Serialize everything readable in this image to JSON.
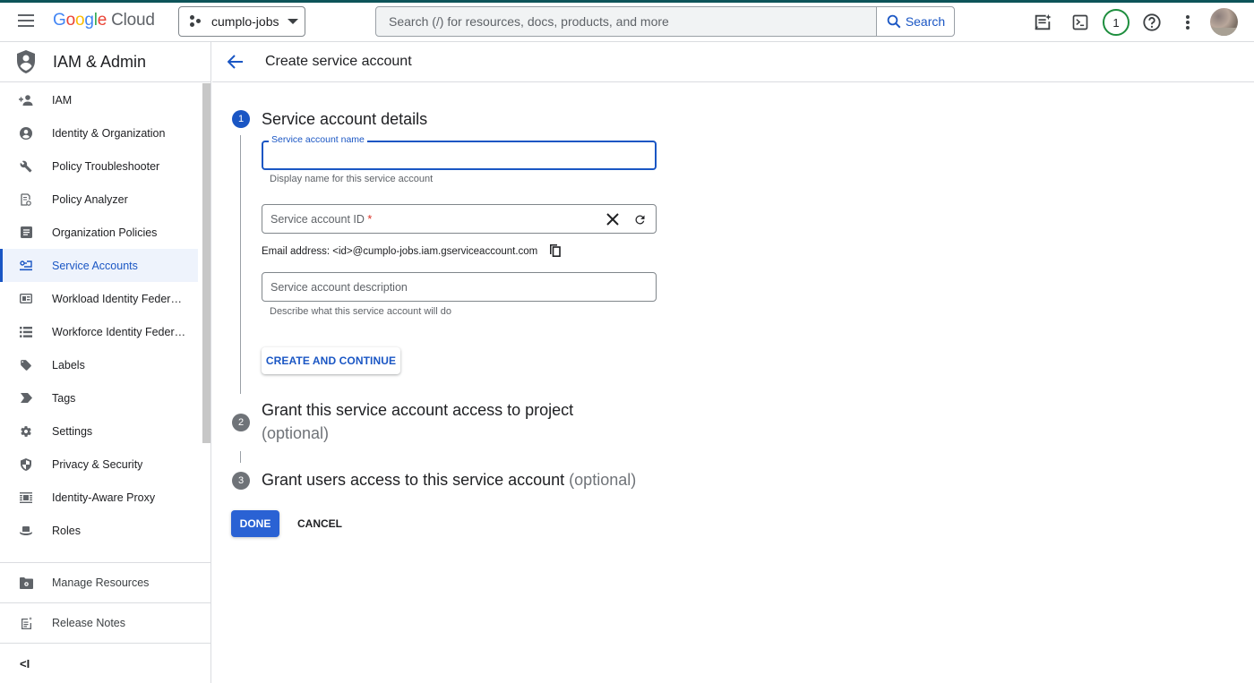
{
  "topbar": {
    "logo_letters": [
      "G",
      "o",
      "o",
      "g",
      "l",
      "e"
    ],
    "logo_product": "Cloud",
    "project": "cumplo-jobs",
    "search_placeholder": "Search (/) for resources, docs, products, and more",
    "search_button": "Search",
    "notifications_count": "1",
    "icons": [
      "menu-icon",
      "gemini-chat-icon",
      "cloud-shell-icon",
      "help-icon",
      "more-vert-icon",
      "account-avatar"
    ],
    "colors": {
      "accent_line": "#0d5459",
      "notification_ring": "#1e8e3e",
      "link": "#1a56c4"
    }
  },
  "sidebar": {
    "title": "IAM & Admin",
    "items": [
      {
        "label": "IAM",
        "icon": "person-add-icon",
        "active": false
      },
      {
        "label": "Identity & Organization",
        "icon": "account-circle-icon",
        "active": false
      },
      {
        "label": "Policy Troubleshooter",
        "icon": "wrench-icon",
        "active": false
      },
      {
        "label": "Policy Analyzer",
        "icon": "policy-analyzer-icon",
        "active": false
      },
      {
        "label": "Organization Policies",
        "icon": "document-icon",
        "active": false
      },
      {
        "label": "Service Accounts",
        "icon": "service-account-icon",
        "active": true
      },
      {
        "label": "Workload Identity Federat...",
        "icon": "workload-identity-icon",
        "active": false
      },
      {
        "label": "Workforce Identity Federa...",
        "icon": "list-icon",
        "active": false
      },
      {
        "label": "Labels",
        "icon": "label-tag-icon",
        "active": false
      },
      {
        "label": "Tags",
        "icon": "tag-arrow-icon",
        "active": false
      },
      {
        "label": "Settings",
        "icon": "settings-gear-icon",
        "active": false
      },
      {
        "label": "Privacy & Security",
        "icon": "shield-icon",
        "active": false
      },
      {
        "label": "Identity-Aware Proxy",
        "icon": "proxy-icon",
        "active": false
      },
      {
        "label": "Roles",
        "icon": "hat-icon",
        "active": false
      }
    ],
    "footer": [
      {
        "label": "Manage Resources",
        "icon": "folder-settings-icon"
      },
      {
        "label": "Release Notes",
        "icon": "release-notes-icon"
      }
    ],
    "collapse_label": "<I"
  },
  "main": {
    "title": "Create service account",
    "steps": [
      {
        "number": "1",
        "title": "Service account details",
        "optional": ""
      },
      {
        "number": "2",
        "title": "Grant this service account access to project",
        "optional": "(optional)"
      },
      {
        "number": "3",
        "title": "Grant users access to this service account",
        "optional": "(optional)"
      }
    ],
    "form": {
      "name_label": "Service account name",
      "name_value": "",
      "name_hint": "Display name for this service account",
      "id_label": "Service account ID",
      "id_required": "*",
      "id_value": "",
      "email_text": "Email address: <id>@cumplo-jobs.iam.gserviceaccount.com",
      "description_placeholder": "Service account description",
      "description_value": "",
      "description_hint": "Describe what this service account will do",
      "create_button": "CREATE AND CONTINUE"
    },
    "done_button": "DONE",
    "cancel_button": "CANCEL"
  }
}
